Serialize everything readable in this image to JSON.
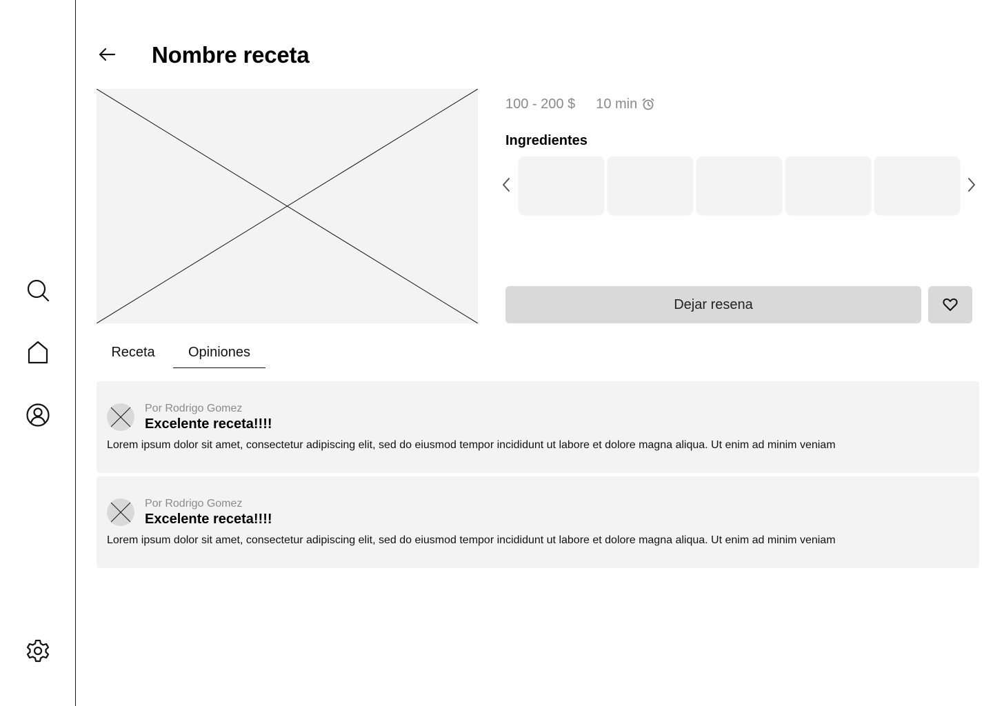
{
  "sidebar": {
    "items": [
      {
        "icon": "search-icon"
      },
      {
        "icon": "home-icon"
      },
      {
        "icon": "profile-icon"
      },
      {
        "icon": "gear-icon"
      }
    ]
  },
  "header": {
    "back_icon": "arrow-left-icon",
    "title": "Nombre receta"
  },
  "recipe": {
    "price": "100 - 200 $",
    "time": "10 min",
    "time_icon": "alarm-clock-icon",
    "ingredients_heading": "Ingredientes",
    "ingredient_cards": [
      "",
      "",
      "",
      "",
      ""
    ],
    "review_button": "Dejar resena",
    "favorite_icon": "heart-icon"
  },
  "tabs": [
    {
      "label": "Receta",
      "active": false
    },
    {
      "label": "Opiniones",
      "active": true
    }
  ],
  "comments": [
    {
      "author": "Por Rodrigo Gomez",
      "title": "Excelente receta!!!!",
      "body": "Lorem ipsum dolor sit amet, consectetur adipiscing elit, sed do eiusmod tempor incididunt ut labore et dolore magna aliqua. Ut enim ad minim veniam"
    },
    {
      "author": "Por Rodrigo Gomez",
      "title": "Excelente receta!!!!",
      "body": "Lorem ipsum dolor sit amet, consectetur adipiscing elit, sed do eiusmod tempor incididunt ut labore et dolore magna aliqua. Ut enim ad minim veniam"
    }
  ],
  "colors": {
    "placeholder_bg": "#f3f3f3",
    "button_bg": "#d9d9d9",
    "muted_text": "#8a8a8a"
  }
}
